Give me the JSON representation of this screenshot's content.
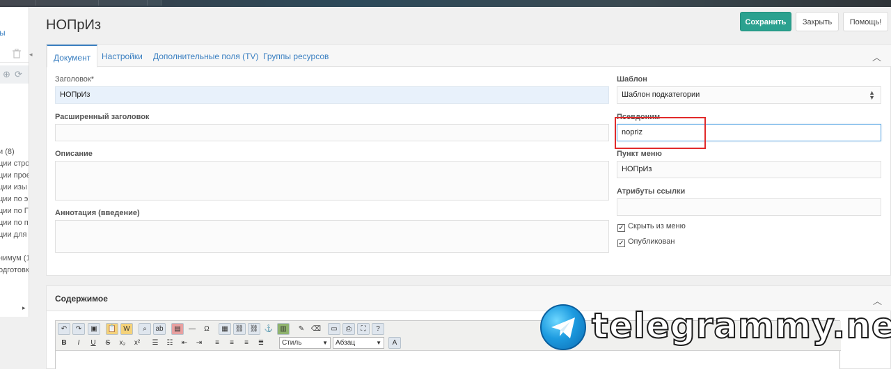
{
  "page": {
    "title": "НОПрИз"
  },
  "actions": {
    "save": "Сохранить",
    "close": "Закрыть",
    "help": "Помощь!"
  },
  "tabs": [
    {
      "label": "Документ",
      "active": true
    },
    {
      "label": "Настройки"
    },
    {
      "label": "Дополнительные поля (TV)"
    },
    {
      "label": "Группы ресурсов"
    }
  ],
  "sidebar": {
    "top_text": "ы",
    "items": [
      "и (8)",
      "ции стро",
      "ции прое",
      "ции изы",
      "ции по э",
      "ции по Г",
      "ции по п",
      "ции для",
      "",
      "нимум (1",
      "одготовк"
    ]
  },
  "form": {
    "title_label": "Заголовок*",
    "title_value": "НОПрИз",
    "longtitle_label": "Расширенный заголовок",
    "longtitle_value": "",
    "description_label": "Описание",
    "introtext_label": "Аннотация (введение)",
    "template_label": "Шаблон",
    "template_value": "Шаблон подкатегории",
    "alias_label": "Псевдоним",
    "alias_value": "nopriz",
    "menutitle_label": "Пункт меню",
    "menutitle_value": "НОПрИз",
    "link_attr_label": "Атрибуты ссылки",
    "link_attr_value": "",
    "hidemenu_label": "Скрыть из меню",
    "published_label": "Опубликован"
  },
  "content": {
    "title": "Содержимое",
    "style_select": "Стиль",
    "format_select": "Абзац"
  },
  "watermark": {
    "text": "telegrammy.net"
  },
  "colors": {
    "accent": "#3a7fc1",
    "save": "#2ba18f",
    "highlight": "#e12a2a"
  }
}
